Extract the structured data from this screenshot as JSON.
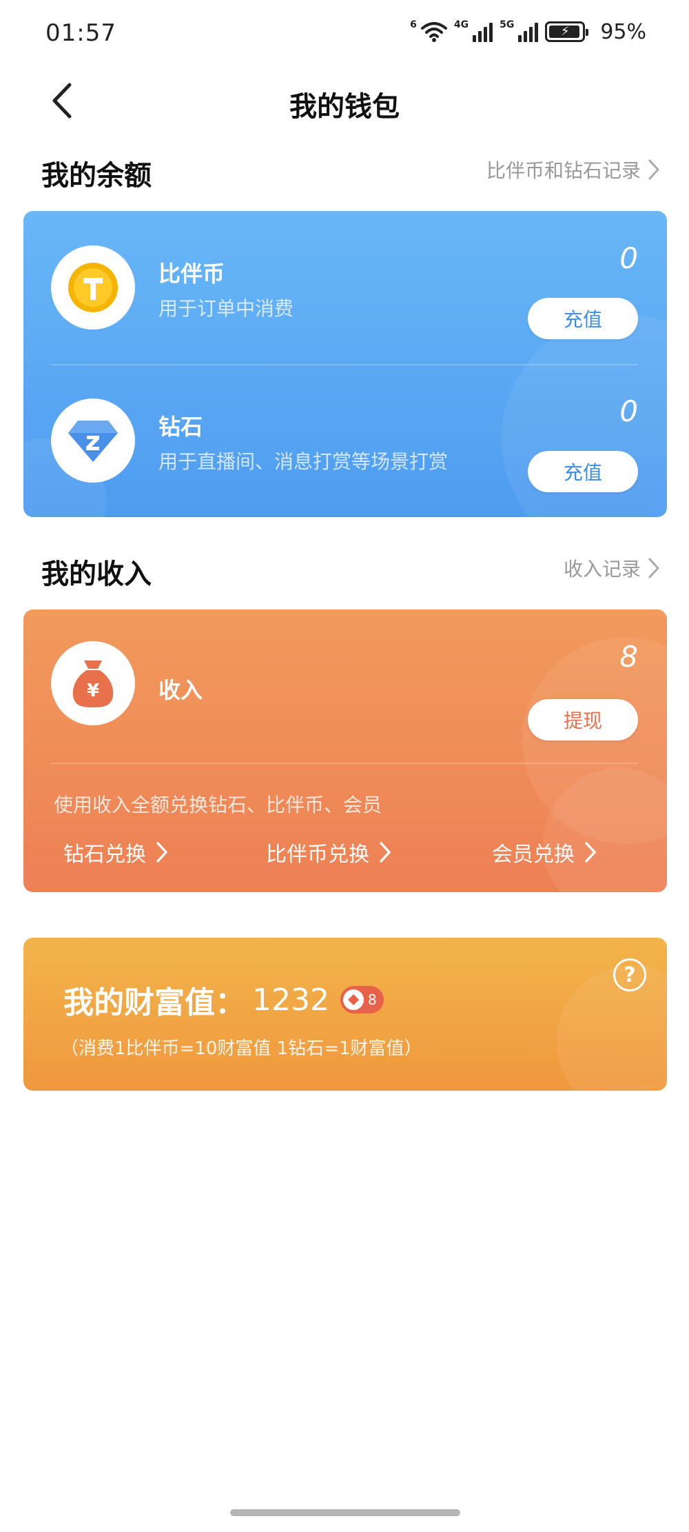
{
  "status_bar": {
    "time": "01:57",
    "wifi_label": "6",
    "net1_label": "4G",
    "net2_label": "5G",
    "battery_percent": "95%"
  },
  "header": {
    "title": "我的钱包",
    "back_icon": "chevron-left-icon"
  },
  "balance_section": {
    "title": "我的余额",
    "link_label": "比伴币和钻石记录",
    "items": [
      {
        "name": "比伴币",
        "desc": "用于订单中消费",
        "value": "0",
        "button": "充值",
        "icon": "gold-coin-icon"
      },
      {
        "name": "钻石",
        "desc": "用于直播间、消息打赏等场景打赏",
        "value": "0",
        "button": "充值",
        "icon": "diamond-icon"
      }
    ]
  },
  "income_section": {
    "title": "我的收入",
    "link_label": "收入记录",
    "item": {
      "name": "收入",
      "value": "8",
      "button": "提现",
      "icon": "money-bag-icon"
    },
    "note": "使用收入全额兑换钻石、比伴币、会员",
    "exchanges": [
      "钻石兑换",
      "比伴币兑换",
      "会员兑换"
    ]
  },
  "wealth": {
    "label": "我的财富值：",
    "value": "1232",
    "badge": "8",
    "note": "（消费1比伴币=10财富值 1钻石=1财富值）",
    "help": "?"
  },
  "colors": {
    "balance_card": "#5aa8f4",
    "income_card": "#ef8c58",
    "wealth_card": "#f1a744",
    "coin_gold": "#f5b400",
    "diamond_blue": "#4a8fe8"
  }
}
